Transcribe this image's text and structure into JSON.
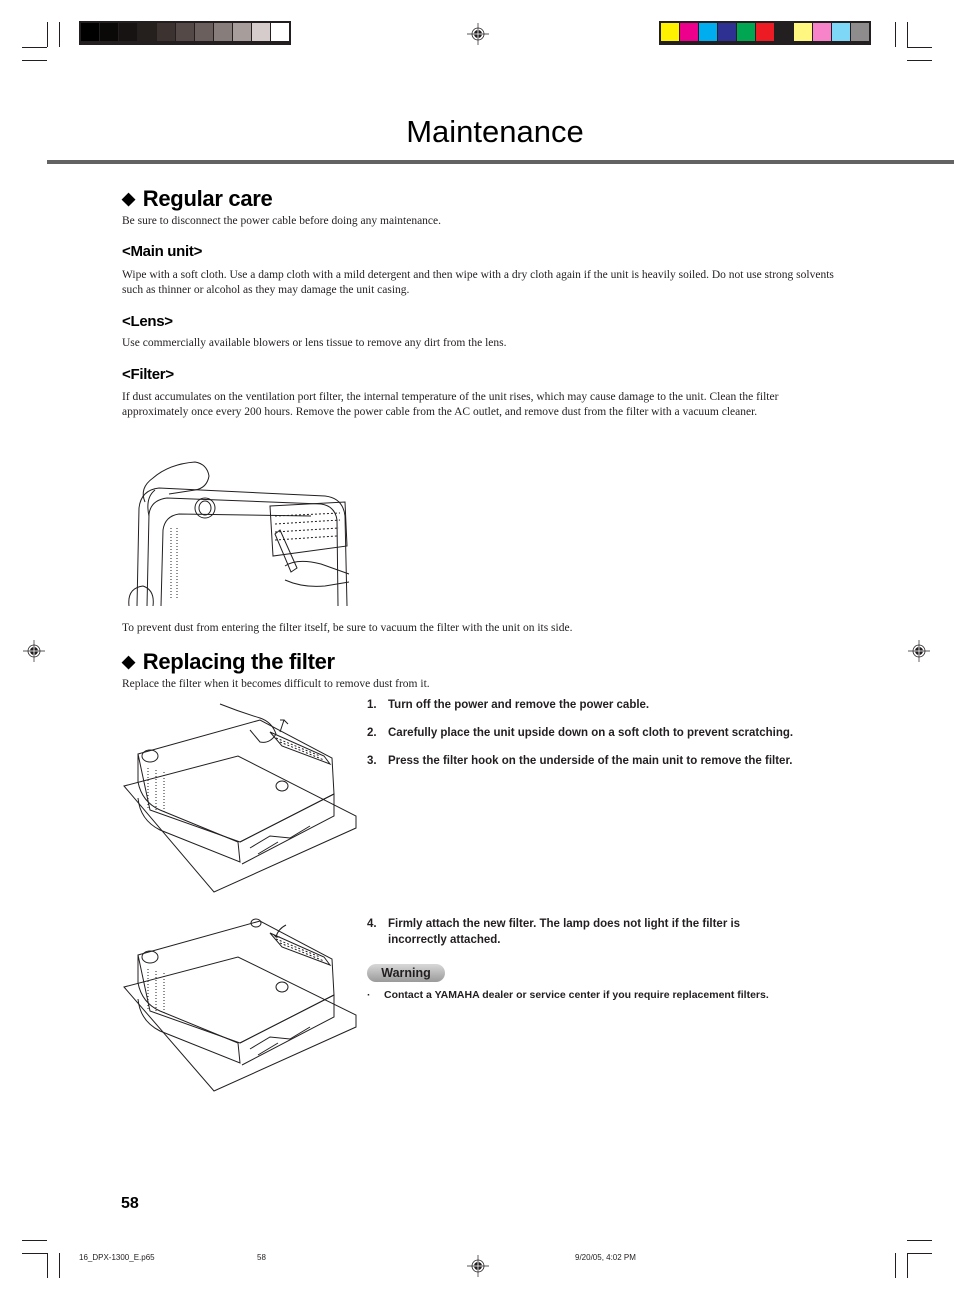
{
  "print_marks": {
    "grayscale_swatches": [
      "#000000",
      "#0b0908",
      "#171312",
      "#25201d",
      "#3c3330",
      "#544946",
      "#6a5f5c",
      "#877e7b",
      "#a79e9c",
      "#d5cccb",
      "#ffffff"
    ],
    "color_swatches": [
      "#fff200",
      "#ec008c",
      "#00aeef",
      "#2e3192",
      "#00a651",
      "#ed1c24",
      "#231f20",
      "#fff77f",
      "#f783c8",
      "#7fd7f7",
      "#8e8c8c"
    ]
  },
  "page": {
    "title": "Maintenance",
    "page_number": "58"
  },
  "regular_care": {
    "heading": "Regular care",
    "intro": "Be sure to disconnect the power cable before doing any maintenance.",
    "main_unit": {
      "heading": "<Main unit>",
      "text": "Wipe with a soft cloth. Use a damp cloth with a mild detergent and then wipe with a dry cloth again if the unit is heavily soiled. Do not use strong solvents such as thinner or alcohol as they may damage the unit casing."
    },
    "lens": {
      "heading": "<Lens>",
      "text": "Use commercially available blowers or lens tissue to remove any dirt from the lens."
    },
    "filter": {
      "heading": "<Filter>",
      "text": "If dust accumulates on the ventilation port filter, the internal temperature of the unit rises, which may cause damage to the unit. Clean the filter approximately once every 200 hours. Remove the power cable from the AC outlet, and remove dust from the filter with a vacuum cleaner."
    },
    "after_illustration": "To prevent dust from entering the filter itself, be sure to vacuum the filter with the unit on its side."
  },
  "replacing_filter": {
    "heading": "Replacing the filter",
    "intro": "Replace the filter when it becomes difficult to remove dust from it.",
    "steps": [
      {
        "num": "1.",
        "text": "Turn off the power and remove the power cable."
      },
      {
        "num": "2.",
        "text": "Carefully place the unit upside down on a soft cloth to prevent scratching."
      },
      {
        "num": "3.",
        "text": "Press the filter hook on the underside of the main unit to remove the filter."
      },
      {
        "num": "4.",
        "text": "Firmly attach the new filter. The lamp does not light if the filter is incorrectly attached."
      }
    ],
    "warning_label": "Warning",
    "warning_items": [
      "Contact a YAMAHA dealer or service center if you require replacement filters."
    ]
  },
  "slug": {
    "filename": "16_DPX-1300_E.p65",
    "page": "58",
    "datetime": "9/20/05, 4:02 PM"
  },
  "symbols": {
    "diamond": "◆",
    "bullet": "·"
  }
}
